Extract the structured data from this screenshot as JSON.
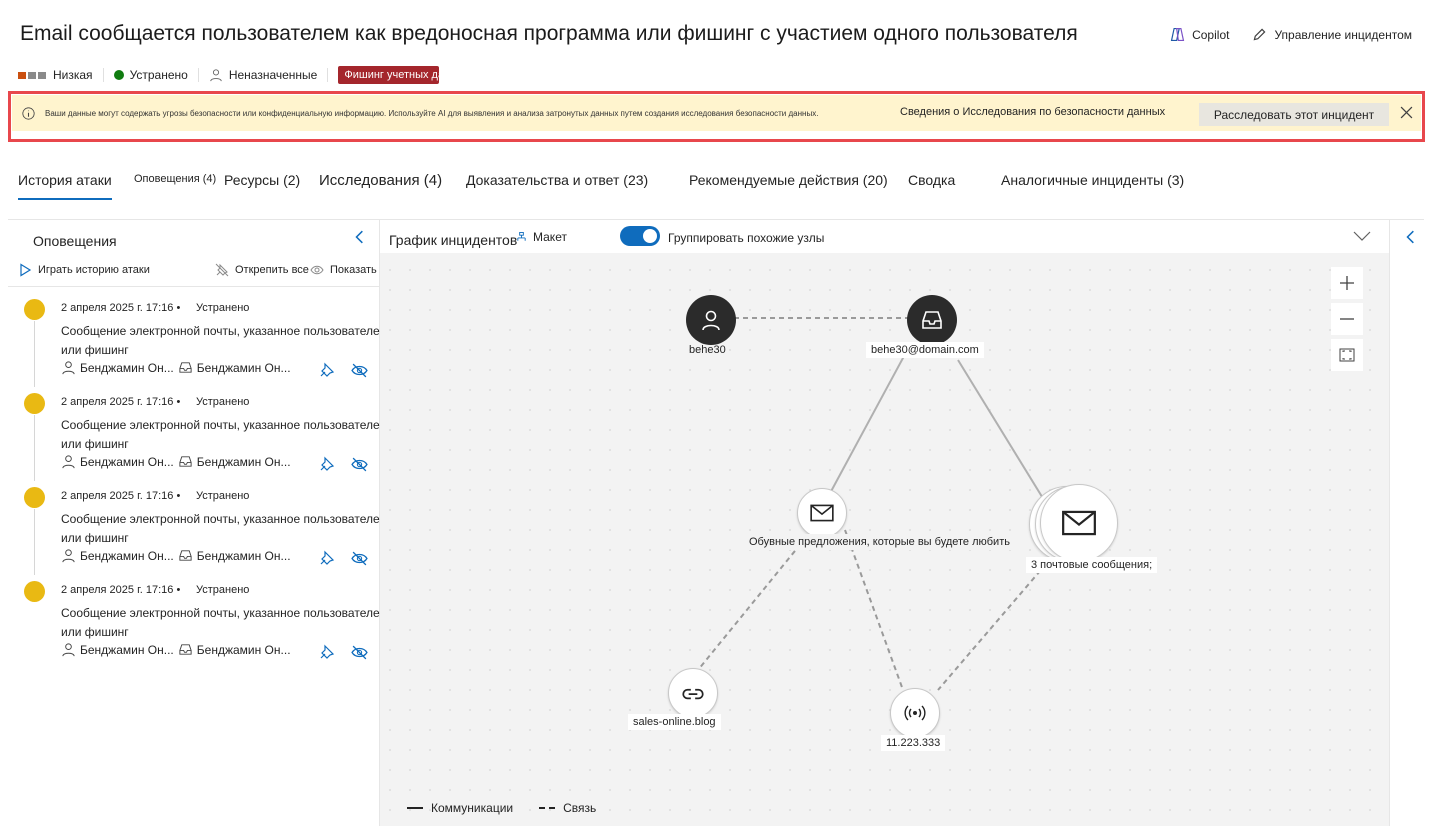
{
  "header": {
    "title": "Email сообщается пользователем как вредоносная программа или фишинг с участием одного пользователя",
    "actions": {
      "copilot": "Copilot",
      "manage": "Управление инцидентом"
    }
  },
  "meta": {
    "severity": "Низкая",
    "status": "Устранено",
    "assigned": "Неназначенные",
    "tag": "Фишинг учетных данных"
  },
  "banner": {
    "message": "Ваши данные могут содержать угрозы безопасности или конфиденциальную информацию. Используйте AI для выявления и анализа затронутых данных путем создания исследования безопасности данных.",
    "link": "Сведения о Исследования по безопасности данных",
    "button": "Расследовать этот инцидент"
  },
  "tabs": [
    {
      "label": "История атаки"
    },
    {
      "label": "Оповещения (4)"
    },
    {
      "label": "Ресурсы (2)"
    },
    {
      "label": "Исследования (4)"
    },
    {
      "label": "Доказательства и ответ (23)"
    },
    {
      "label": "Рекомендуемые действия (20)"
    },
    {
      "label": "Сводка"
    },
    {
      "label": "Аналогичные инциденты (3)"
    }
  ],
  "alerts_panel": {
    "title": "Оповещения",
    "play": "Играть историю атаки",
    "unpin": "Открепить все",
    "show_all": "Показать все",
    "items": [
      {
        "date": "2 апреля 2025 г. 17:16 •",
        "status": "Устранено",
        "desc": "Сообщение электронной почты, указанное пользователем как вредоносная программа или фишинг",
        "user": "Бенджамин Он...",
        "mailbox": "Бенджамин Он..."
      },
      {
        "date": "2 апреля 2025 г. 17:16 •",
        "status": "Устранено",
        "desc": "Сообщение электронной почты, указанное пользователем как вредоносная программа или фишинг",
        "user": "Бенджамин Он...",
        "mailbox": "Бенджамин Он..."
      },
      {
        "date": "2 апреля 2025 г. 17:16 •",
        "status": "Устранено",
        "desc": "Сообщение электронной почты, указанное пользователем как вредоносная программа или фишинг",
        "user": "Бенджамин Он...",
        "mailbox": "Бенджамин Он..."
      },
      {
        "date": "2 апреля 2025 г. 17:16 •",
        "status": "Устранено",
        "desc": "Сообщение электронной почты, указанное пользователем как вредоносная программа или фишинг",
        "user": "Бенджамин Он...",
        "mailbox": "Бенджамин Он..."
      }
    ]
  },
  "graph": {
    "title": "График инцидентов",
    "layout": "Макет",
    "group_similar": "Группировать похожие узлы",
    "nodes": {
      "user": "behe30",
      "mailbox": "behe30@domain.com",
      "email": "Обувные предложения, которые вы будете любить",
      "emails_group": "3  почтовые сообщения;",
      "url": "sales-online.blog",
      "ip": "11.223.333"
    },
    "legend": {
      "solid": "Коммуникации",
      "dashed": "Связь"
    }
  },
  "colors": {
    "accent": "#0f6cbd",
    "severity_low": "#e9b913",
    "resolved": "#107c10",
    "tag": "#a4262c",
    "banner": "#fff4ce",
    "highlight": "#e8474c"
  }
}
